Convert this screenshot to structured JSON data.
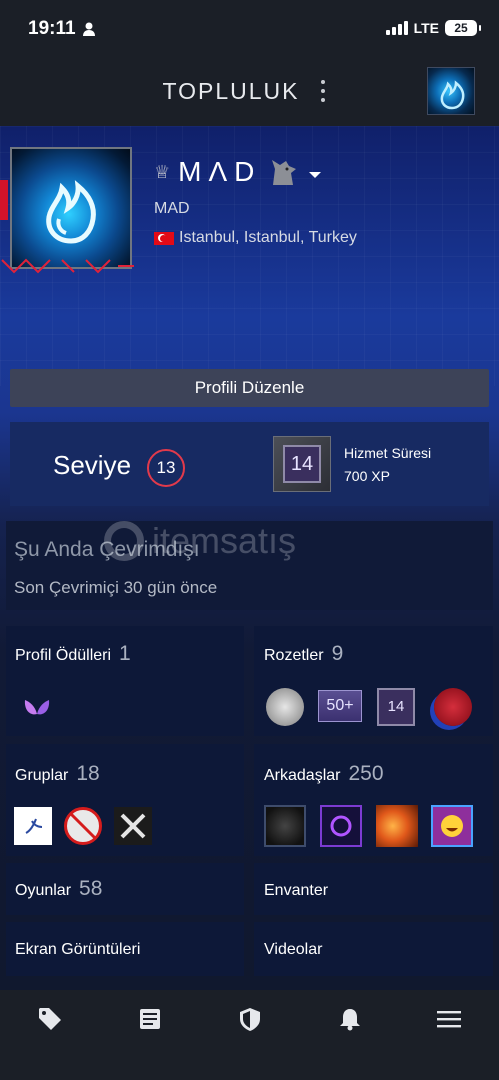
{
  "status_bar": {
    "time": "19:11",
    "network": "LTE",
    "battery": "25"
  },
  "header": {
    "title": "TOPLULUK"
  },
  "profile": {
    "persona_name": "MΛD",
    "real_name": "MAD",
    "location": "Istanbul, Istanbul, Turkey",
    "edit_button": "Profili Düzenle"
  },
  "level": {
    "label": "Seviye",
    "value": "13",
    "badge_number": "14",
    "badge_title": "Hizmet Süresi",
    "badge_xp": "700 XP"
  },
  "status": {
    "title": "Şu Anda Çevrimdışı",
    "subtitle": "Son Çevrimiçi 30 gün önce"
  },
  "watermark": "itemsatış",
  "sections": {
    "profile_awards": {
      "label": "Profil Ödülleri",
      "count": "1"
    },
    "badges": {
      "label": "Rozetler",
      "count": "9",
      "badge_50": "50+",
      "badge_14": "14"
    },
    "groups": {
      "label": "Gruplar",
      "count": "18"
    },
    "friends": {
      "label": "Arkadaşlar",
      "count": "250"
    },
    "games": {
      "label": "Oyunlar",
      "count": "58"
    },
    "inventory": {
      "label": "Envanter"
    },
    "screenshots": {
      "label": "Ekran Görüntüleri"
    },
    "videos": {
      "label": "Videolar"
    }
  },
  "bottom_nav": [
    "store-tag-icon",
    "news-icon",
    "shield-icon",
    "bell-icon",
    "menu-icon"
  ]
}
